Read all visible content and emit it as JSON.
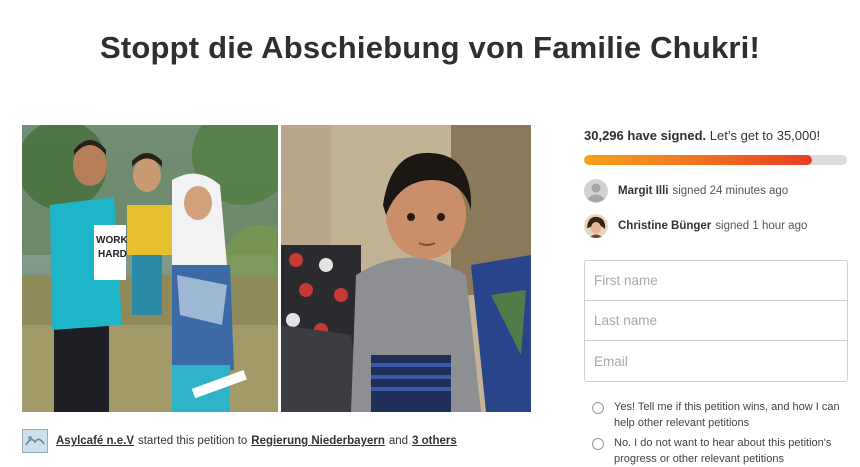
{
  "page": {
    "title": "Stoppt die Abschiebung von Familie Chukri!"
  },
  "starter": {
    "org_name": "Asylcafé n.e.V",
    "text_mid": "started this petition to",
    "target": "Regierung Niederbayern",
    "and_text": "and",
    "others": "3 others"
  },
  "signatures": {
    "count": "30,296 have signed.",
    "goal_text": "Let’s get to 35,000!",
    "progress_fraction": 0.8656
  },
  "recent_signers": [
    {
      "name": "Margit Illi",
      "action": "signed 24 minutes ago"
    },
    {
      "name": "Christine Bünger",
      "action": "signed 1 hour ago"
    }
  ],
  "form": {
    "first_name_placeholder": "First name",
    "last_name_placeholder": "Last name",
    "email_placeholder": "Email"
  },
  "options": {
    "yes_label": "Yes! Tell me if this petition wins, and how I can help other relevant petitions",
    "no_label": "No. I do not want to hear about this petition's progress or other relevant petitions"
  },
  "colors": {
    "progress_start": "#f7a21b",
    "progress_end": "#e63d23",
    "progress_track": "#dcdcdc"
  }
}
